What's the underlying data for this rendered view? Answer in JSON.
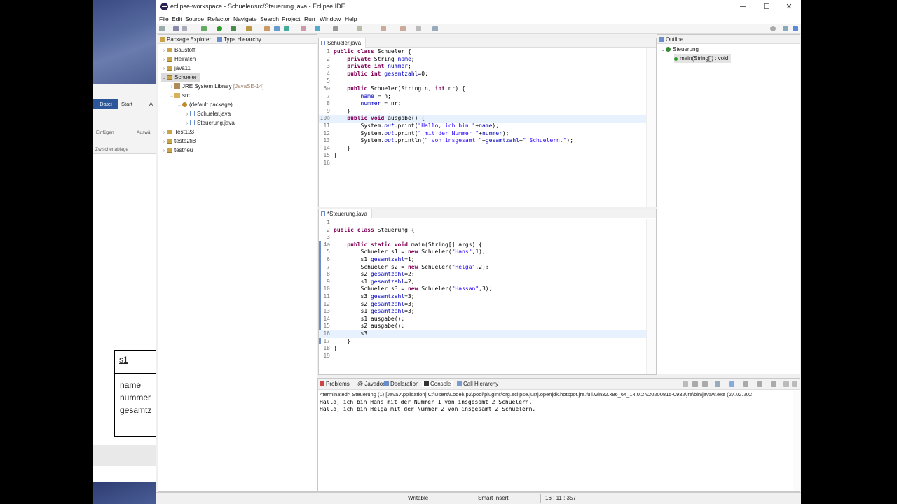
{
  "window": {
    "title": "eclipse-workspace - Schueler/src/Steuerung.java - Eclipse IDE",
    "minimize": "─",
    "maximize": "☐",
    "close": "✕"
  },
  "menu": [
    "File",
    "Edit",
    "Source",
    "Refactor",
    "Navigate",
    "Search",
    "Project",
    "Run",
    "Window",
    "Help"
  ],
  "package_explorer": {
    "tabs": [
      "Package Explorer",
      "Type Hierarchy"
    ],
    "tree": [
      {
        "label": "Baustoff",
        "depth": 0,
        "twisty": "›",
        "icon": "project-icon"
      },
      {
        "label": "Heiraten",
        "depth": 0,
        "twisty": "›",
        "icon": "project-icon"
      },
      {
        "label": "java11",
        "depth": 0,
        "twisty": "›",
        "icon": "project-icon"
      },
      {
        "label": "Schueler",
        "depth": 0,
        "twisty": "⌄",
        "icon": "project-icon",
        "selected": true
      },
      {
        "label": "JRE System Library",
        "suffix": "[JavaSE-14]",
        "depth": 1,
        "twisty": "›",
        "icon": "library-icon"
      },
      {
        "label": "src",
        "depth": 1,
        "twisty": "⌄",
        "icon": "source-folder-icon"
      },
      {
        "label": "(default package)",
        "depth": 2,
        "twisty": "⌄",
        "icon": "package-icon"
      },
      {
        "label": "Schueler.java",
        "depth": 3,
        "twisty": "›",
        "icon": "java-file-icon"
      },
      {
        "label": "Steuerung.java",
        "depth": 3,
        "twisty": "›",
        "icon": "java-file-icon"
      },
      {
        "label": "Test123",
        "depth": 0,
        "twisty": "›",
        "icon": "project-icon"
      },
      {
        "label": "teste2fi8",
        "depth": 0,
        "twisty": "›",
        "icon": "project-icon"
      },
      {
        "label": "testneu",
        "depth": 0,
        "twisty": "›",
        "icon": "project-icon"
      }
    ]
  },
  "editor1": {
    "tab": "Schueler.java",
    "lines": [
      {
        "n": "1",
        "t": "public class Schueler {"
      },
      {
        "n": "2",
        "t": "    private String name;"
      },
      {
        "n": "3",
        "t": "    private int nummer;"
      },
      {
        "n": "4",
        "t": "    public int gesamtzahl=0;"
      },
      {
        "n": "5",
        "t": ""
      },
      {
        "n": "6⊖",
        "t": "    public Schueler(String n, int nr) {"
      },
      {
        "n": "7",
        "t": "        name = n;"
      },
      {
        "n": "8",
        "t": "        nummer = nr;"
      },
      {
        "n": "9",
        "t": "    }"
      },
      {
        "n": "10⊖",
        "t": "    public void ausgabe() {"
      },
      {
        "n": "11",
        "t": "        System.out.print(\"Hallo, ich bin \"+name);"
      },
      {
        "n": "12",
        "t": "        System.out.print(\" mit der Nummer \"+nummer);"
      },
      {
        "n": "13",
        "t": "        System.out.println(\" von insgesamt \"+gesamtzahl+\" Schuelern.\");"
      },
      {
        "n": "14",
        "t": "    }"
      },
      {
        "n": "15",
        "t": "}"
      },
      {
        "n": "16",
        "t": ""
      }
    ]
  },
  "editor2": {
    "tab": "*Steuerung.java",
    "lines": [
      {
        "n": "1",
        "t": ""
      },
      {
        "n": "2",
        "t": "public class Steuerung {"
      },
      {
        "n": "3",
        "t": ""
      },
      {
        "n": "4⊖",
        "t": "    public static void main(String[] args) {"
      },
      {
        "n": "5",
        "t": "        Schueler s1 = new Schueler(\"Hans\",1);"
      },
      {
        "n": "6",
        "t": "        s1.gesamtzahl=1;"
      },
      {
        "n": "7",
        "t": "        Schueler s2 = new Schueler(\"Helga\",2);"
      },
      {
        "n": "8",
        "t": "        s2.gesamtzahl=2;"
      },
      {
        "n": "9",
        "t": "        s1.gesamtzahl=2;"
      },
      {
        "n": "10",
        "t": "        Schueler s3 = new Schueler(\"Hassan\",3);"
      },
      {
        "n": "11",
        "t": "        s3.gesamtzahl=3;"
      },
      {
        "n": "12",
        "t": "        s2.gesamtzahl=3;"
      },
      {
        "n": "13",
        "t": "        s1.gesamtzahl=3;"
      },
      {
        "n": "14",
        "t": "        s1.ausgabe();"
      },
      {
        "n": "15",
        "t": "        s2.ausgabe();"
      },
      {
        "n": "16",
        "t": "        s3"
      },
      {
        "n": "17",
        "t": "    }"
      },
      {
        "n": "18",
        "t": "}"
      },
      {
        "n": "19",
        "t": ""
      }
    ]
  },
  "outline": {
    "tab": "Outline",
    "class": "Steuerung",
    "method": "main(String[]) : void"
  },
  "console": {
    "tabs": [
      "Problems",
      "@ Javadoc",
      "Declaration",
      "Console",
      "Call Hierarchy"
    ],
    "terminated": "<terminated> Steuerung (1) [Java Application] C:\\Users\\Lödel\\.p2\\pool\\plugins\\org.eclipse.justj.openjdk.hotspot.jre.full.win32.x86_64_14.0.2.v20200815-0932\\jre\\bin\\javaw.exe  (27.02.202",
    "output": [
      "Hallo, ich bin Hans mit der Nummer 1 von insgesamt 2 Schuelern.",
      "Hallo, ich bin Helga mit der Nummer 2 von insgesamt 2 Schuelern."
    ]
  },
  "status": {
    "writable": "Writable",
    "insert_mode": "Smart Insert",
    "position": "16 : 11 : 357"
  },
  "background_word": {
    "tabs": [
      "Datei",
      "Start",
      "A"
    ],
    "paste": "Einfügen",
    "select": "Auswä",
    "clipboard": "Zwischenablage",
    "uml_title": "s1",
    "uml_attrs": "name =\nnummer\ngesamtz"
  }
}
